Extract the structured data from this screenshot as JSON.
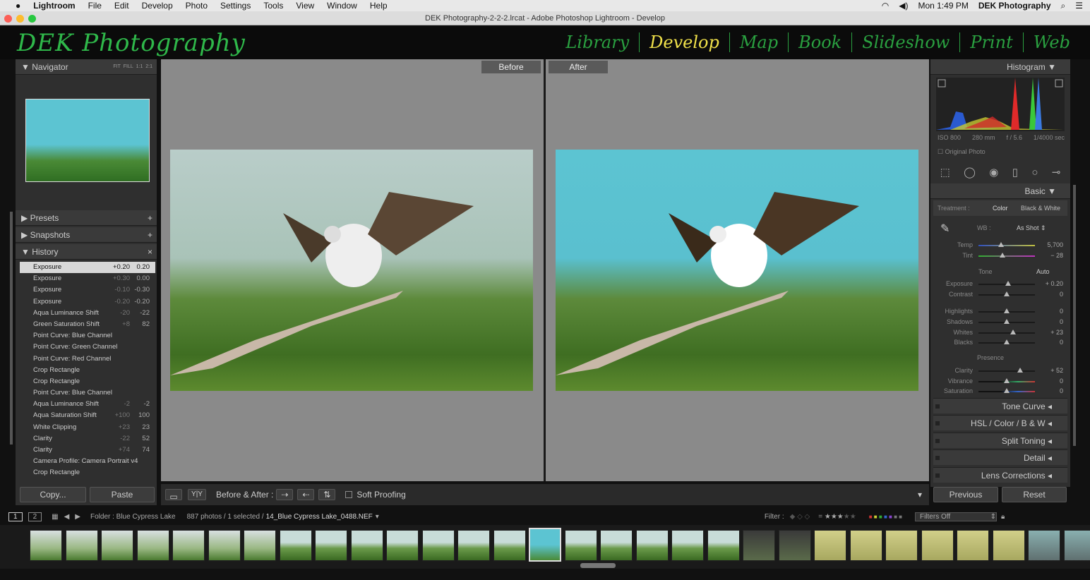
{
  "menubar": {
    "app": "Lightroom",
    "items": [
      "File",
      "Edit",
      "Develop",
      "Photo",
      "Settings",
      "Tools",
      "View",
      "Window",
      "Help"
    ],
    "clock": "Mon 1:49 PM",
    "user": "DEK Photography"
  },
  "window_title": "DEK Photography-2-2-2.lrcat - Adobe Photoshop Lightroom - Develop",
  "identity_plate": "DEK Photography",
  "modules": [
    {
      "label": "Library"
    },
    {
      "label": "Develop",
      "active": true
    },
    {
      "label": "Map"
    },
    {
      "label": "Book"
    },
    {
      "label": "Slideshow"
    },
    {
      "label": "Print"
    },
    {
      "label": "Web"
    }
  ],
  "navigator": {
    "title": "Navigator",
    "zoom_options": [
      "FIT",
      "FILL",
      "1:1",
      "2:1"
    ]
  },
  "presets": {
    "title": "Presets"
  },
  "snapshots": {
    "title": "Snapshots"
  },
  "history": {
    "title": "History",
    "items": [
      {
        "name": "Exposure",
        "delta": "+0.20",
        "value": "0.20",
        "selected": true
      },
      {
        "name": "Exposure",
        "delta": "+0.30",
        "value": "0.00"
      },
      {
        "name": "Exposure",
        "delta": "-0.10",
        "value": "-0.30"
      },
      {
        "name": "Exposure",
        "delta": "-0.20",
        "value": "-0.20"
      },
      {
        "name": "Aqua Luminance Shift",
        "delta": "-20",
        "value": "-22"
      },
      {
        "name": "Green Saturation Shift",
        "delta": "+8",
        "value": "82"
      },
      {
        "name": "Point Curve: Blue Channel",
        "delta": "",
        "value": ""
      },
      {
        "name": "Point Curve: Green Channel",
        "delta": "",
        "value": ""
      },
      {
        "name": "Point Curve: Red Channel",
        "delta": "",
        "value": ""
      },
      {
        "name": "Crop Rectangle",
        "delta": "",
        "value": ""
      },
      {
        "name": "Crop Rectangle",
        "delta": "",
        "value": ""
      },
      {
        "name": "Point Curve: Blue Channel",
        "delta": "",
        "value": ""
      },
      {
        "name": "Aqua Luminance Shift",
        "delta": "-2",
        "value": "-2"
      },
      {
        "name": "Aqua Saturation Shift",
        "delta": "+100",
        "value": "100"
      },
      {
        "name": "White Clipping",
        "delta": "+23",
        "value": "23"
      },
      {
        "name": "Clarity",
        "delta": "-22",
        "value": "52"
      },
      {
        "name": "Clarity",
        "delta": "+74",
        "value": "74"
      },
      {
        "name": "Camera Profile: Camera Portrait v4",
        "delta": "",
        "value": ""
      },
      {
        "name": "Crop Rectangle",
        "delta": "",
        "value": ""
      }
    ]
  },
  "left_buttons": {
    "copy": "Copy...",
    "paste": "Paste"
  },
  "view": {
    "before": "Before",
    "after": "After"
  },
  "toolbar": {
    "before_after": "Before & After :",
    "soft_proofing": "Soft Proofing",
    "soft_proofing_checked": false
  },
  "histogram": {
    "title": "Histogram",
    "iso": "ISO 800",
    "focal": "280 mm",
    "aperture": "f / 5.6",
    "shutter": "1/4000 sec",
    "original_photo": "Original Photo"
  },
  "basic": {
    "title": "Basic",
    "treatment_label": "Treatment :",
    "treatment_color": "Color",
    "treatment_bw": "Black & White",
    "wb_label": "WB :",
    "wb_value": "As Shot",
    "tone_label": "Tone",
    "auto": "Auto",
    "presence_label": "Presence",
    "sliders": [
      {
        "label": "Temp",
        "value": "5,700",
        "pos": 0.4
      },
      {
        "label": "Tint",
        "value": "− 28",
        "pos": 0.42
      },
      {
        "label": "Exposure",
        "value": "+ 0.20",
        "pos": 0.52
      },
      {
        "label": "Contrast",
        "value": "0",
        "pos": 0.5
      },
      {
        "label": "Highlights",
        "value": "0",
        "pos": 0.5
      },
      {
        "label": "Shadows",
        "value": "0",
        "pos": 0.5
      },
      {
        "label": "Whites",
        "value": "+ 23",
        "pos": 0.61
      },
      {
        "label": "Blacks",
        "value": "0",
        "pos": 0.5
      },
      {
        "label": "Clarity",
        "value": "+ 52",
        "pos": 0.74
      },
      {
        "label": "Vibrance",
        "value": "0",
        "pos": 0.5
      },
      {
        "label": "Saturation",
        "value": "0",
        "pos": 0.5
      }
    ]
  },
  "sections": [
    "Tone Curve",
    "HSL / Color / B & W",
    "Split Toning",
    "Detail",
    "Lens Corrections"
  ],
  "right_buttons": {
    "previous": "Previous",
    "reset": "Reset"
  },
  "filmstrip": {
    "pages": [
      "1",
      "2"
    ],
    "folder": "Folder : Blue Cypress Lake",
    "count": "887 photos / 1 selected /",
    "filename": "14_Blue Cypress Lake_0488.NEF",
    "filter_label": "Filter :",
    "rating_stars": 3,
    "filter_preset": "Filters Off"
  },
  "colors": {
    "accent_green": "#2fb84a",
    "active_module": "#f0e14a",
    "panel_bg": "#2f2f2f",
    "center_bg": "#8a8a8a"
  }
}
